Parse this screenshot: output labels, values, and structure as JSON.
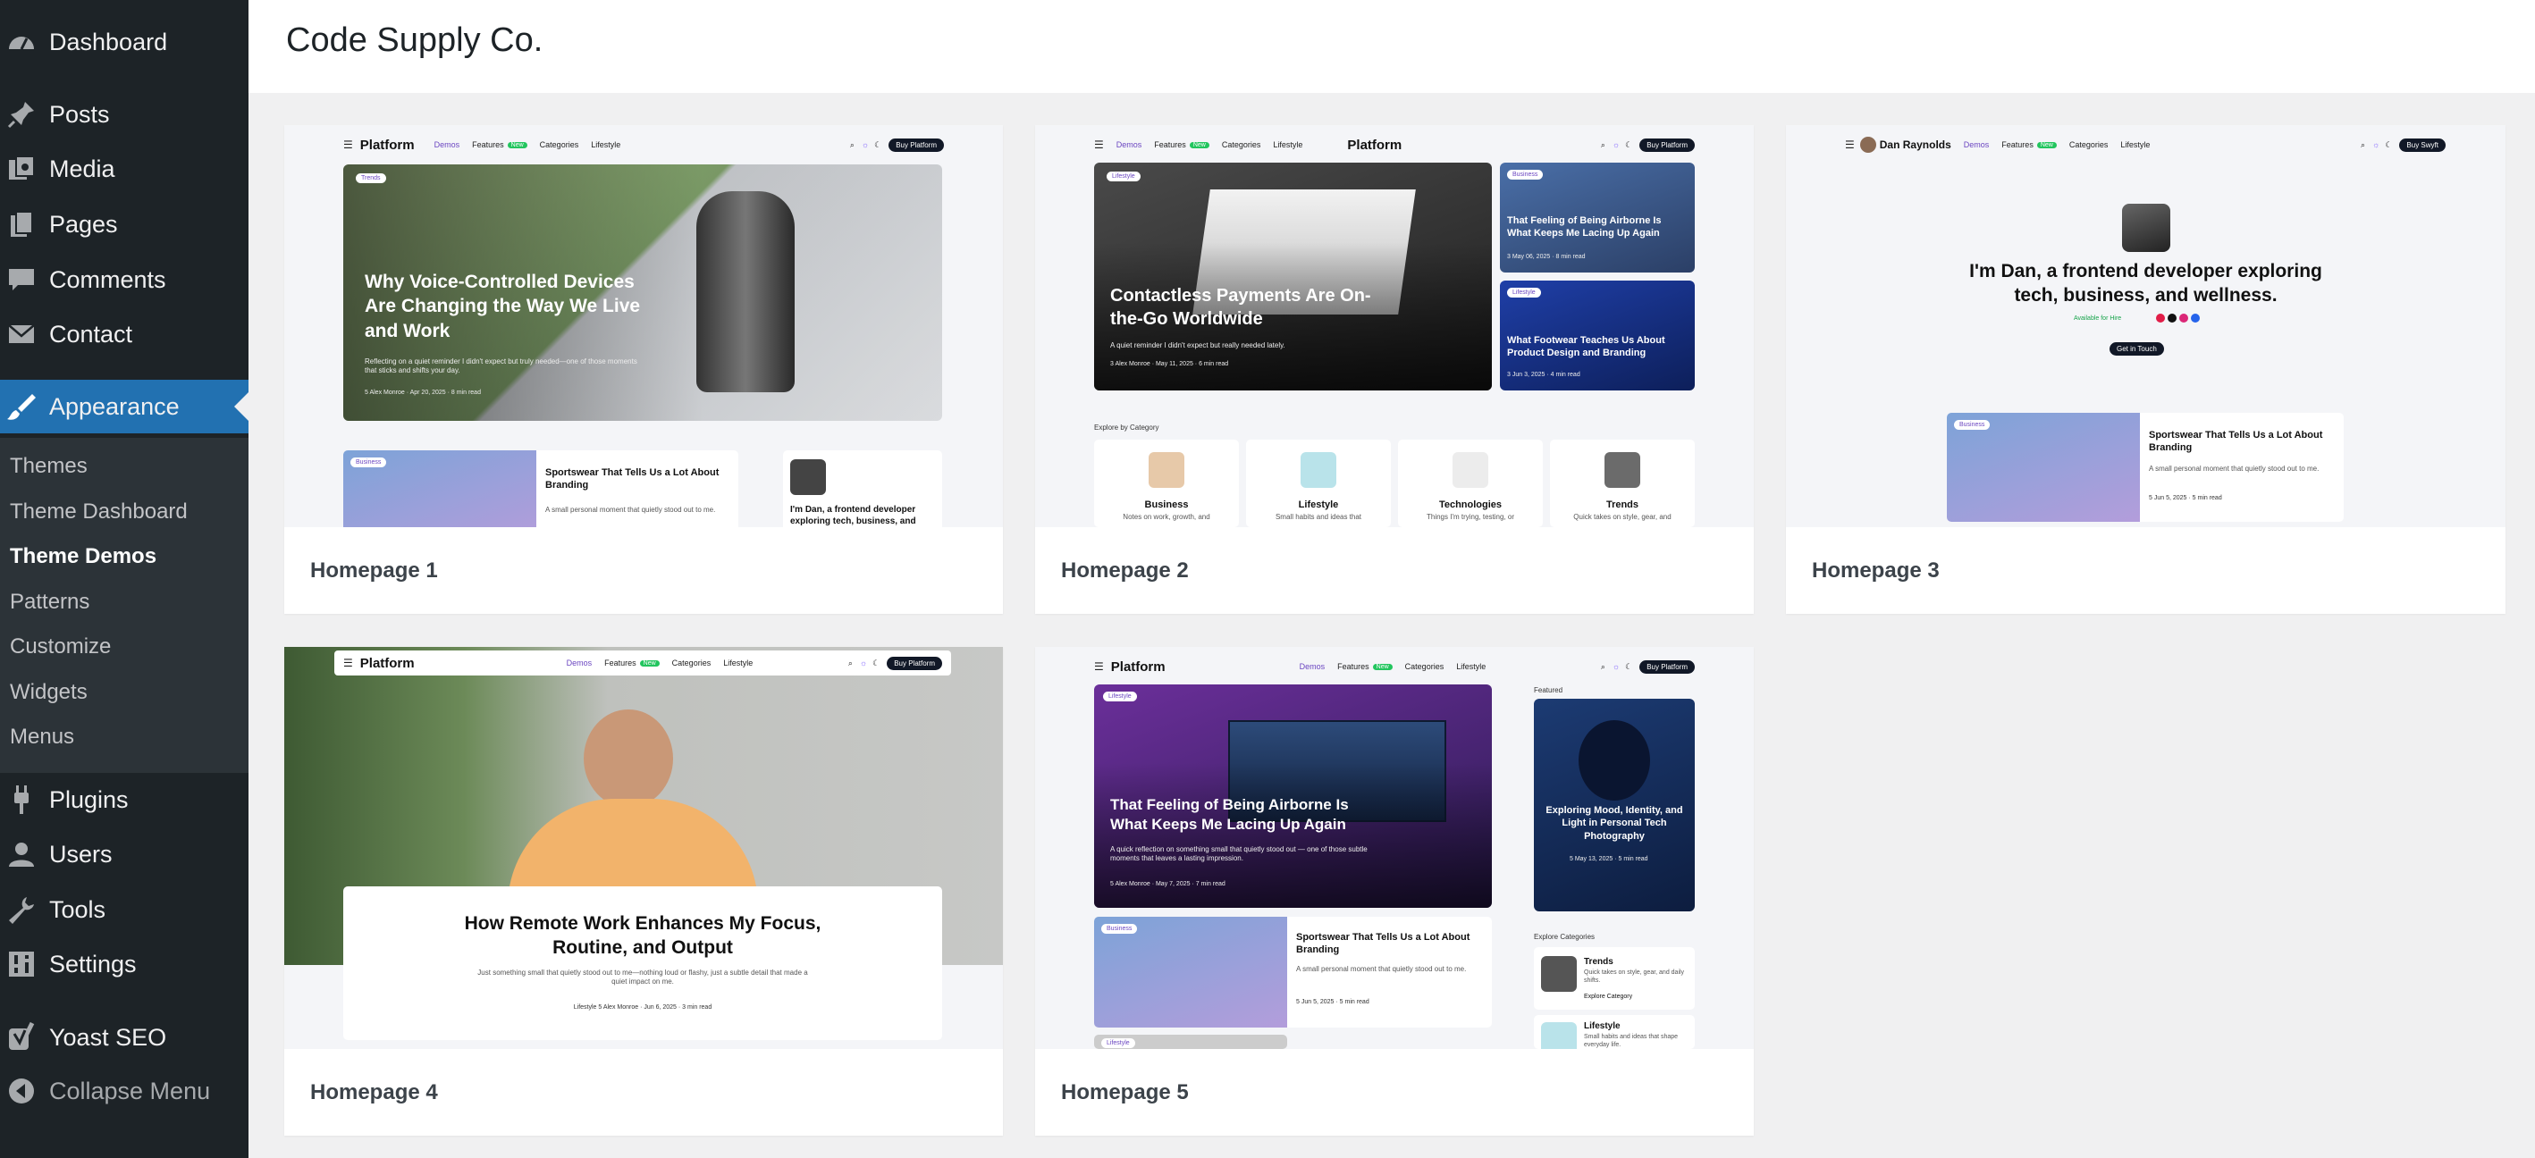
{
  "sidebar": {
    "items": [
      {
        "label": "Dashboard",
        "icon": "dashboard-icon"
      },
      {
        "label": "Posts",
        "icon": "pin-icon"
      },
      {
        "label": "Media",
        "icon": "media-icon"
      },
      {
        "label": "Pages",
        "icon": "pages-icon"
      },
      {
        "label": "Comments",
        "icon": "comment-icon"
      },
      {
        "label": "Contact",
        "icon": "envelope-icon"
      },
      {
        "label": "Appearance",
        "icon": "brush-icon"
      },
      {
        "label": "Plugins",
        "icon": "plug-icon"
      },
      {
        "label": "Users",
        "icon": "user-icon"
      },
      {
        "label": "Tools",
        "icon": "wrench-icon"
      },
      {
        "label": "Settings",
        "icon": "settings-icon"
      },
      {
        "label": "Yoast SEO",
        "icon": "yoast-icon"
      },
      {
        "label": "Collapse Menu",
        "icon": "collapse-icon"
      }
    ],
    "submenu": [
      "Themes",
      "Theme Dashboard",
      "Theme Demos",
      "Patterns",
      "Customize",
      "Widgets",
      "Menus"
    ],
    "current_sub": "Theme Demos"
  },
  "header": {
    "title": "Code Supply Co."
  },
  "demos": [
    {
      "caption": "Homepage 1"
    },
    {
      "caption": "Homepage 2"
    },
    {
      "caption": "Homepage 3"
    },
    {
      "caption": "Homepage 4"
    },
    {
      "caption": "Homepage 5"
    }
  ],
  "previews": {
    "nav": {
      "logo": "Platform",
      "demos": "Demos",
      "features": "Features",
      "new": "New",
      "categories": "Categories",
      "lifestyle": "Lifestyle",
      "buy": "Buy Platform"
    },
    "h1": {
      "tag": "Trends",
      "hero_title": "Why Voice-Controlled Devices Are Changing the Way We Live and Work",
      "hero_text": "Reflecting on a quiet reminder I didn't expect but truly needed—one of those moments that sticks and shifts your day.",
      "hero_meta": "5  Alex Monroe  ·  Apr 20, 2025  ·  8 min read",
      "card_tag": "Business",
      "card_title": "Sportswear That Tells Us a Lot About Branding",
      "card_text": "A small personal moment that quietly stood out to me.",
      "about": "I'm Dan, a frontend developer exploring tech, business, and"
    },
    "h2": {
      "tag": "Lifestyle",
      "hero_title": "Contactless Payments Are On-the-Go Worldwide",
      "hero_text": "A quiet reminder I didn't expect but really needed lately.",
      "hero_meta": "3  Alex Monroe  ·  May 11, 2025  ·  6 min read",
      "side1_tag": "Business",
      "side1_title": "That Feeling of Being Airborne Is What Keeps Me Lacing Up Again",
      "side1_meta": "3  May 06, 2025  ·  8 min read",
      "side2_tag": "Lifestyle",
      "side2_title": "What Footwear Teaches Us About Product Design and Branding",
      "side2_meta": "3  Jun 3, 2025  ·  4 min read",
      "explore": "Explore by Category",
      "cats": [
        {
          "name": "Business",
          "desc": "Notes on work, growth, and"
        },
        {
          "name": "Lifestyle",
          "desc": "Small habits and ideas that"
        },
        {
          "name": "Technologies",
          "desc": "Things I'm trying, testing, or"
        },
        {
          "name": "Trends",
          "desc": "Quick takes on style, gear, and"
        }
      ]
    },
    "h3": {
      "logo": "Dan Raynolds",
      "buy": "Buy Swyft",
      "intro": "I'm Dan, a frontend developer exploring tech, business, and wellness.",
      "available": "Available for Hire",
      "cta": "Get in Touch",
      "card_tag": "Business",
      "card_title": "Sportswear That Tells Us a Lot About Branding",
      "card_text": "A small personal moment that quietly stood out to me.",
      "card_meta": "5  Jun 5, 2025  ·  5 min read"
    },
    "h4": {
      "title": "How Remote Work Enhances My Focus, Routine, and Output",
      "text": "Just something small that quietly stood out to me—nothing loud or flashy, just a subtle detail that made a quiet impact on me.",
      "meta": "Lifestyle   5  Alex Monroe  ·  Jun 6, 2025  ·  3 min read"
    },
    "h5": {
      "tag": "Lifestyle",
      "hero_title": "That Feeling of Being Airborne Is What Keeps Me Lacing Up Again",
      "hero_text": "A quick reflection on something small that quietly stood out — one of those subtle moments that leaves a lasting impression.",
      "hero_meta": "5  Alex Monroe  ·  May 7, 2025  ·  7 min read",
      "featured": "Featured",
      "feat_title": "Exploring Mood, Identity, and Light in Personal Tech Photography",
      "feat_meta": "5  May 13, 2025  ·  5 min read",
      "card_tag": "Business",
      "card_title": "Sportswear That Tells Us a Lot About Branding",
      "card_text": "A small personal moment that quietly stood out to me.",
      "card_meta": "5  Jun 5, 2025  ·  5 min read",
      "card2_tag": "Lifestyle",
      "explore": "Explore Categories",
      "cat1": "Trends",
      "cat1_desc": "Quick takes on style, gear, and daily shifts.",
      "cat1_link": "Explore Category",
      "cat2": "Lifestyle",
      "cat2_desc": "Small habits and ideas that shape everyday life."
    }
  },
  "colors": {
    "sidebar": "#1d2327",
    "active": "#2271b1",
    "accent": "#7c5cff"
  }
}
